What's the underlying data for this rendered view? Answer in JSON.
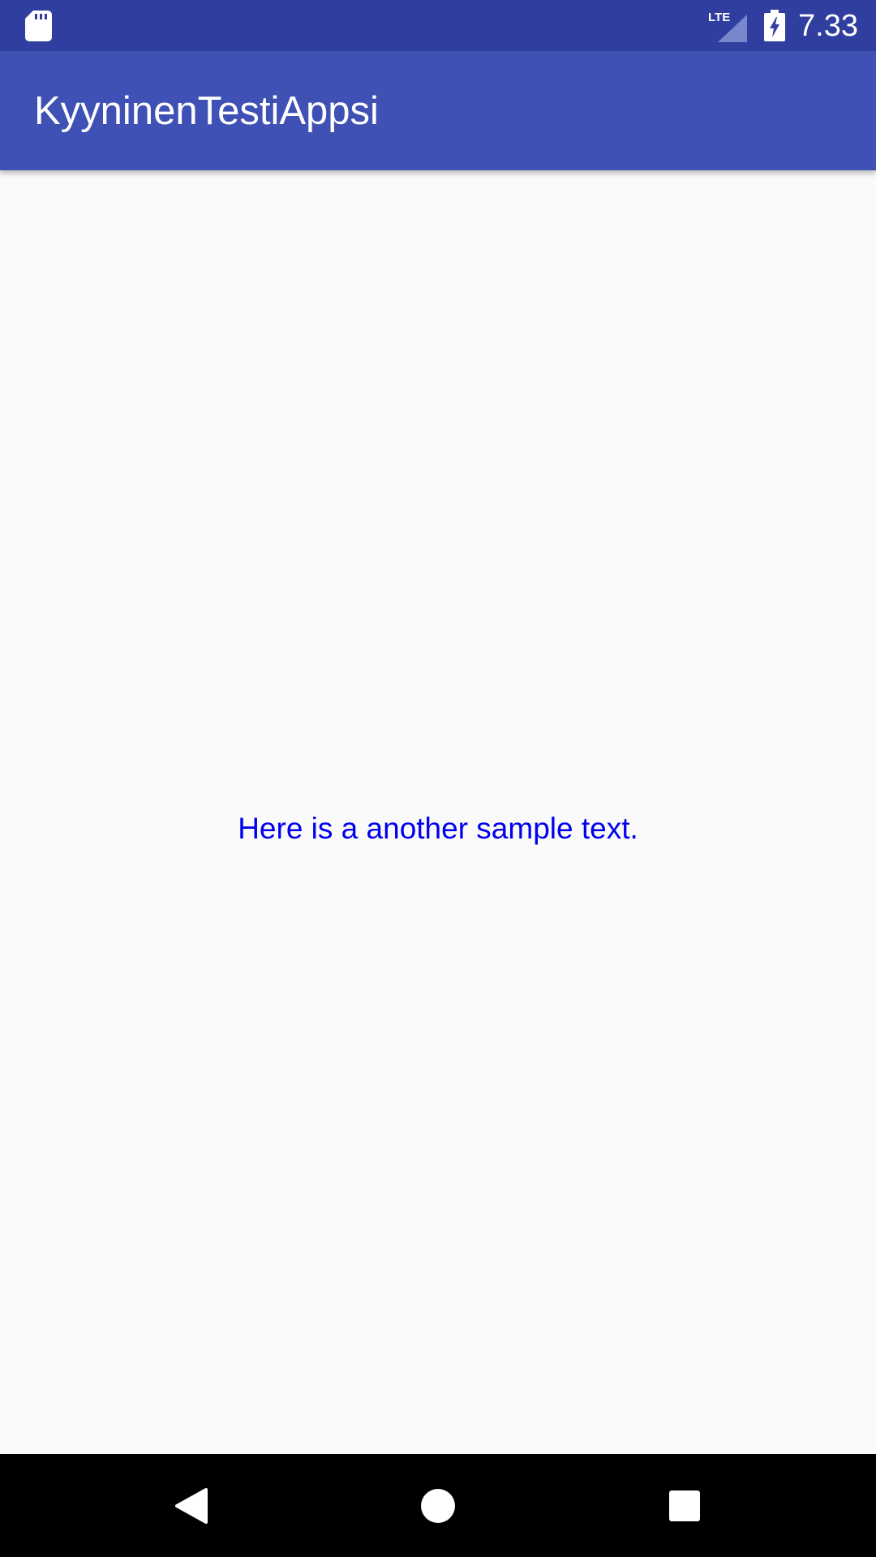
{
  "status_bar": {
    "left_icons": [
      "sd-card-icon"
    ],
    "network_label": "LTE",
    "right_icons": [
      "lte-signal-icon",
      "battery-charging-icon"
    ],
    "time": "7.33",
    "background": "#303f9f"
  },
  "app_bar": {
    "title": "KyyninenTestiAppsi",
    "background": "#3f51b5",
    "text_color": "#ffffff"
  },
  "content": {
    "sample_text": "Here is a another sample text.",
    "text_color": "#0000ee",
    "background": "#fafafa"
  },
  "nav_bar": {
    "buttons": [
      "back-icon",
      "home-icon",
      "recents-icon"
    ],
    "background": "#000000"
  }
}
